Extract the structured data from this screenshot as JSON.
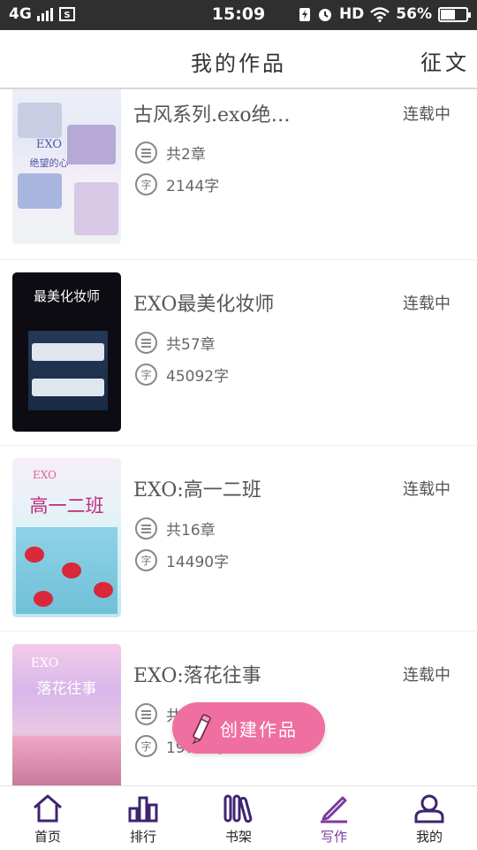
{
  "status_bar": {
    "network": "4G",
    "time": "15:09",
    "hd": "HD",
    "battery": "56%",
    "battery_level": 0.56
  },
  "header": {
    "title": "我的作品",
    "right_action": "征文"
  },
  "works": [
    {
      "title": "古风系列.exo绝…",
      "status": "连载中",
      "chapters": "共2章",
      "words": "2144字",
      "cover_text": [
        "EXO",
        "绝望的心"
      ]
    },
    {
      "title": "EXO最美化妆师",
      "status": "连载中",
      "chapters": "共57章",
      "words": "45092字",
      "cover_text": [
        "最美化妆师"
      ]
    },
    {
      "title": "EXO:高一二班",
      "status": "连载中",
      "chapters": "共16章",
      "words": "14490字",
      "cover_text": [
        "EXO",
        "高一二班"
      ]
    },
    {
      "title": "EXO:落花往事",
      "status": "连载中",
      "chapters": "共",
      "words": "19795字",
      "cover_text": [
        "EXO",
        "落花往事"
      ]
    }
  ],
  "fab": {
    "label": "创建作品"
  },
  "tabs": [
    {
      "label": "首页",
      "icon": "home-icon"
    },
    {
      "label": "排行",
      "icon": "ranking-icon"
    },
    {
      "label": "书架",
      "icon": "bookshelf-icon"
    },
    {
      "label": "写作",
      "icon": "write-icon",
      "active": true
    },
    {
      "label": "我的",
      "icon": "profile-icon"
    }
  ],
  "colors": {
    "accent": "#7c3aa0",
    "fab": "#ef6fa0",
    "status_bar": "#2f2f2f"
  },
  "meta_icon_char": "字"
}
